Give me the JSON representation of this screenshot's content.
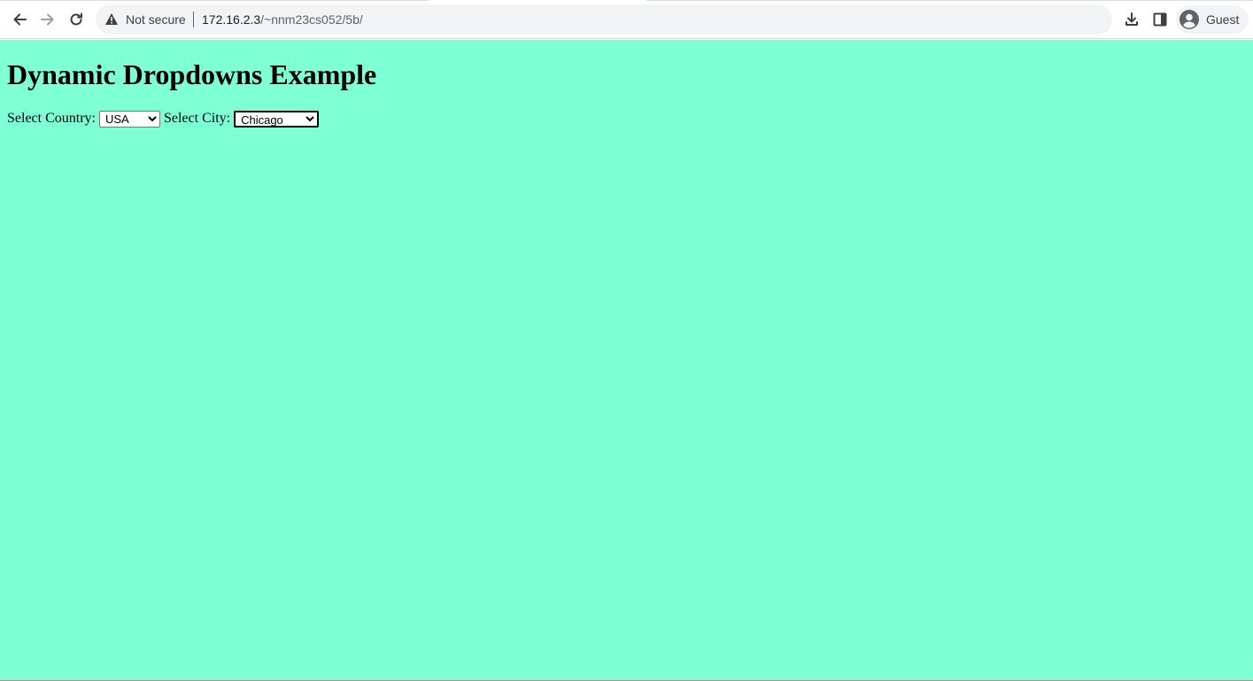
{
  "browser": {
    "security_label": "Not secure",
    "url_host": "172.16.2.3",
    "url_path": "/~nnm23cs052/5b/",
    "profile_name": "Guest",
    "icons": [
      "back-arrow-icon",
      "forward-arrow-icon",
      "reload-icon",
      "warning-icon",
      "download-icon",
      "side-panel-icon",
      "avatar-icon"
    ]
  },
  "page": {
    "background_color": "#7fffd4",
    "heading": "Dynamic Dropdowns Example",
    "country_label": "Select Country:",
    "country_selected": "USA",
    "city_label": "Select City:",
    "city_selected": "Chicago"
  }
}
